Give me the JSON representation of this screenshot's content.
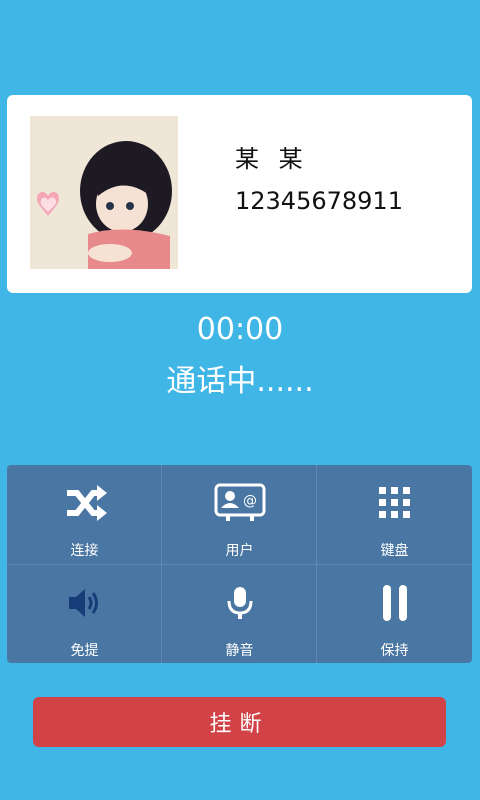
{
  "contact": {
    "name": "某 某",
    "number": "12345678911"
  },
  "call": {
    "timer": "00:00",
    "status": "通话中......"
  },
  "controls": [
    {
      "label": "连接",
      "icon": "shuffle-icon"
    },
    {
      "label": "用户",
      "icon": "contact-card-icon"
    },
    {
      "label": "键盘",
      "icon": "keypad-icon"
    },
    {
      "label": "免提",
      "icon": "speaker-icon"
    },
    {
      "label": "静音",
      "icon": "microphone-icon"
    },
    {
      "label": "保持",
      "icon": "pause-icon"
    }
  ],
  "hangup_label": "挂断",
  "colors": {
    "background": "#3fb6e6",
    "grid": "#4a76a3",
    "hangup": "#d14346"
  }
}
